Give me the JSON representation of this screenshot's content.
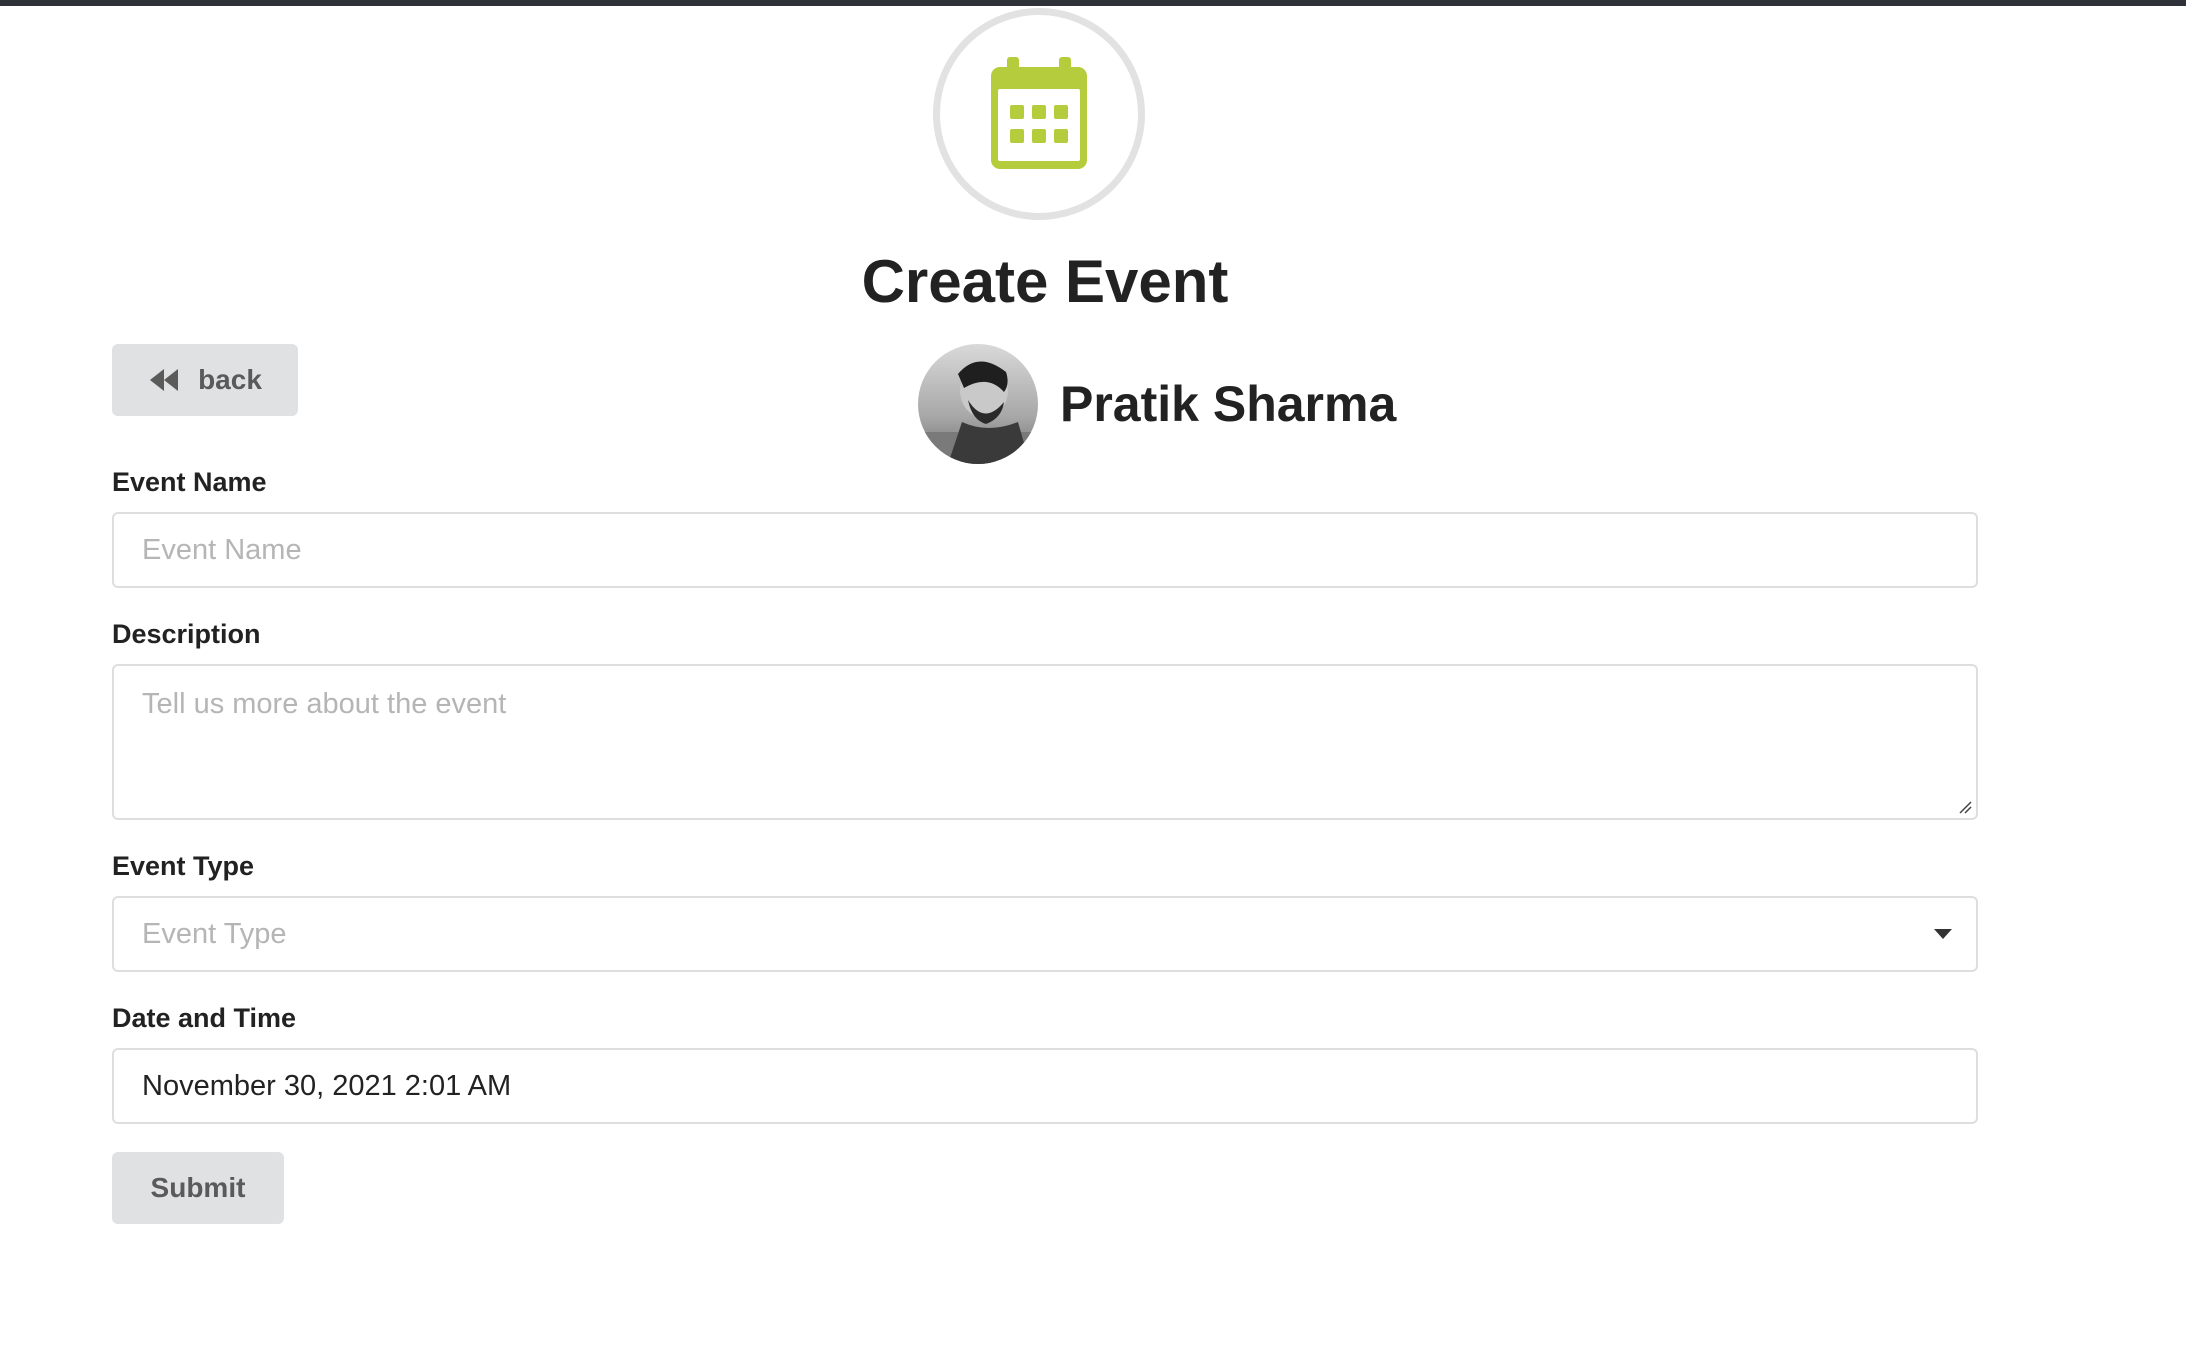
{
  "header": {
    "title": "Create Event",
    "icon": "calendar-icon",
    "icon_color": "#b5cc3c"
  },
  "back_button": {
    "label": "back",
    "icon": "backward-icon"
  },
  "user": {
    "name": "Pratik Sharma",
    "avatar": "avatar-photo"
  },
  "form": {
    "event_name": {
      "label": "Event Name",
      "placeholder": "Event Name",
      "value": ""
    },
    "description": {
      "label": "Description",
      "placeholder": "Tell us more about the event",
      "value": ""
    },
    "event_type": {
      "label": "Event Type",
      "placeholder": "Event Type",
      "value": ""
    },
    "date_time": {
      "label": "Date and Time",
      "value": "November 30, 2021 2:01 AM"
    },
    "submit_label": "Submit"
  }
}
